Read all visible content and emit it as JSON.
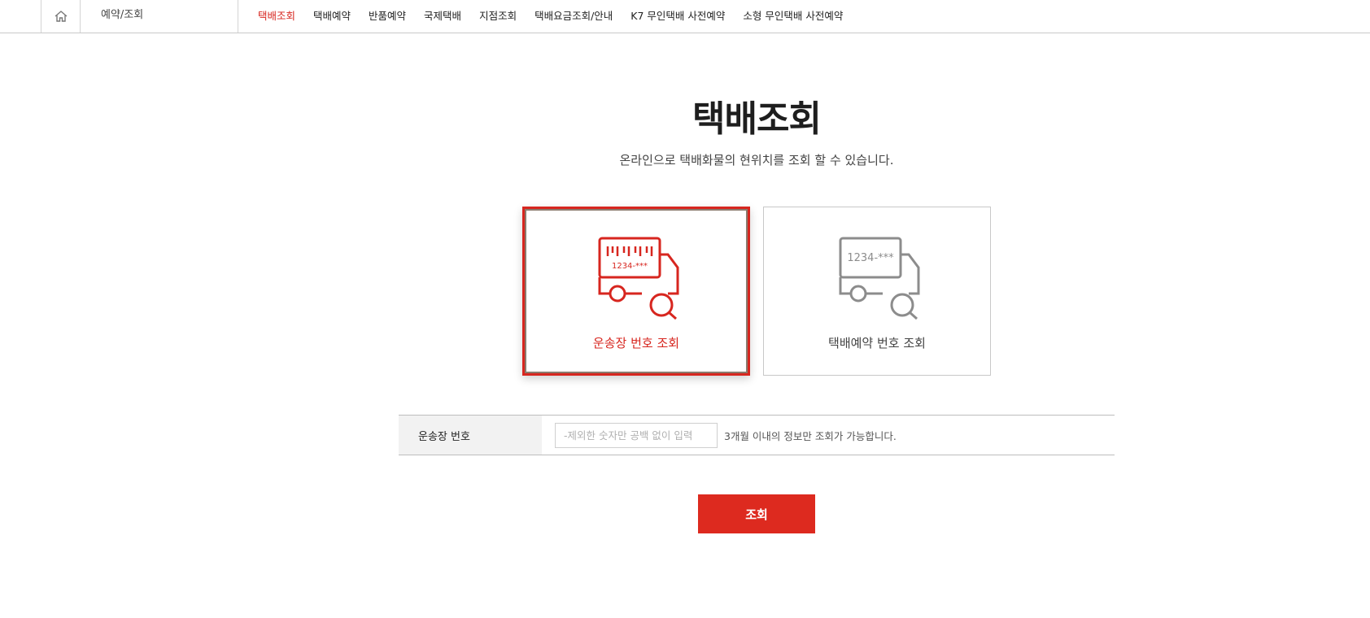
{
  "header": {
    "home_icon": "home-icon",
    "section_label": "예약/조회",
    "nav_items": [
      {
        "label": "택배조회",
        "active": true
      },
      {
        "label": "택배예약"
      },
      {
        "label": "반품예약"
      },
      {
        "label": "국제택배"
      },
      {
        "label": "지점조회"
      },
      {
        "label": "택배요금조회/안내"
      },
      {
        "label": "K7 무인택배 사전예약"
      },
      {
        "label": "소형 무인택배 사전예약"
      }
    ]
  },
  "main": {
    "title": "택배조회",
    "subtitle": "온라인으로 택배화물의 현위치를 조회 할 수 있습니다.",
    "options": [
      {
        "label": "운송장 번호 조회",
        "icon_text": "1234-***",
        "icon": "truck-barcode-search-icon",
        "selected": true
      },
      {
        "label": "택배예약 번호 조회",
        "icon_text": "1234-***",
        "icon": "truck-search-icon",
        "selected": false
      }
    ],
    "form": {
      "label": "운송장 번호",
      "input_placeholder": "-제외한 숫자만 공백 없이 입력",
      "input_value": "",
      "hint": "3개월 이내의 정보만 조회가 가능합니다."
    },
    "submit_label": "조회"
  },
  "colors": {
    "accent": "#dd2a1f",
    "active_nav": "#d7261f",
    "inactive_icon": "#8c8c8c"
  }
}
